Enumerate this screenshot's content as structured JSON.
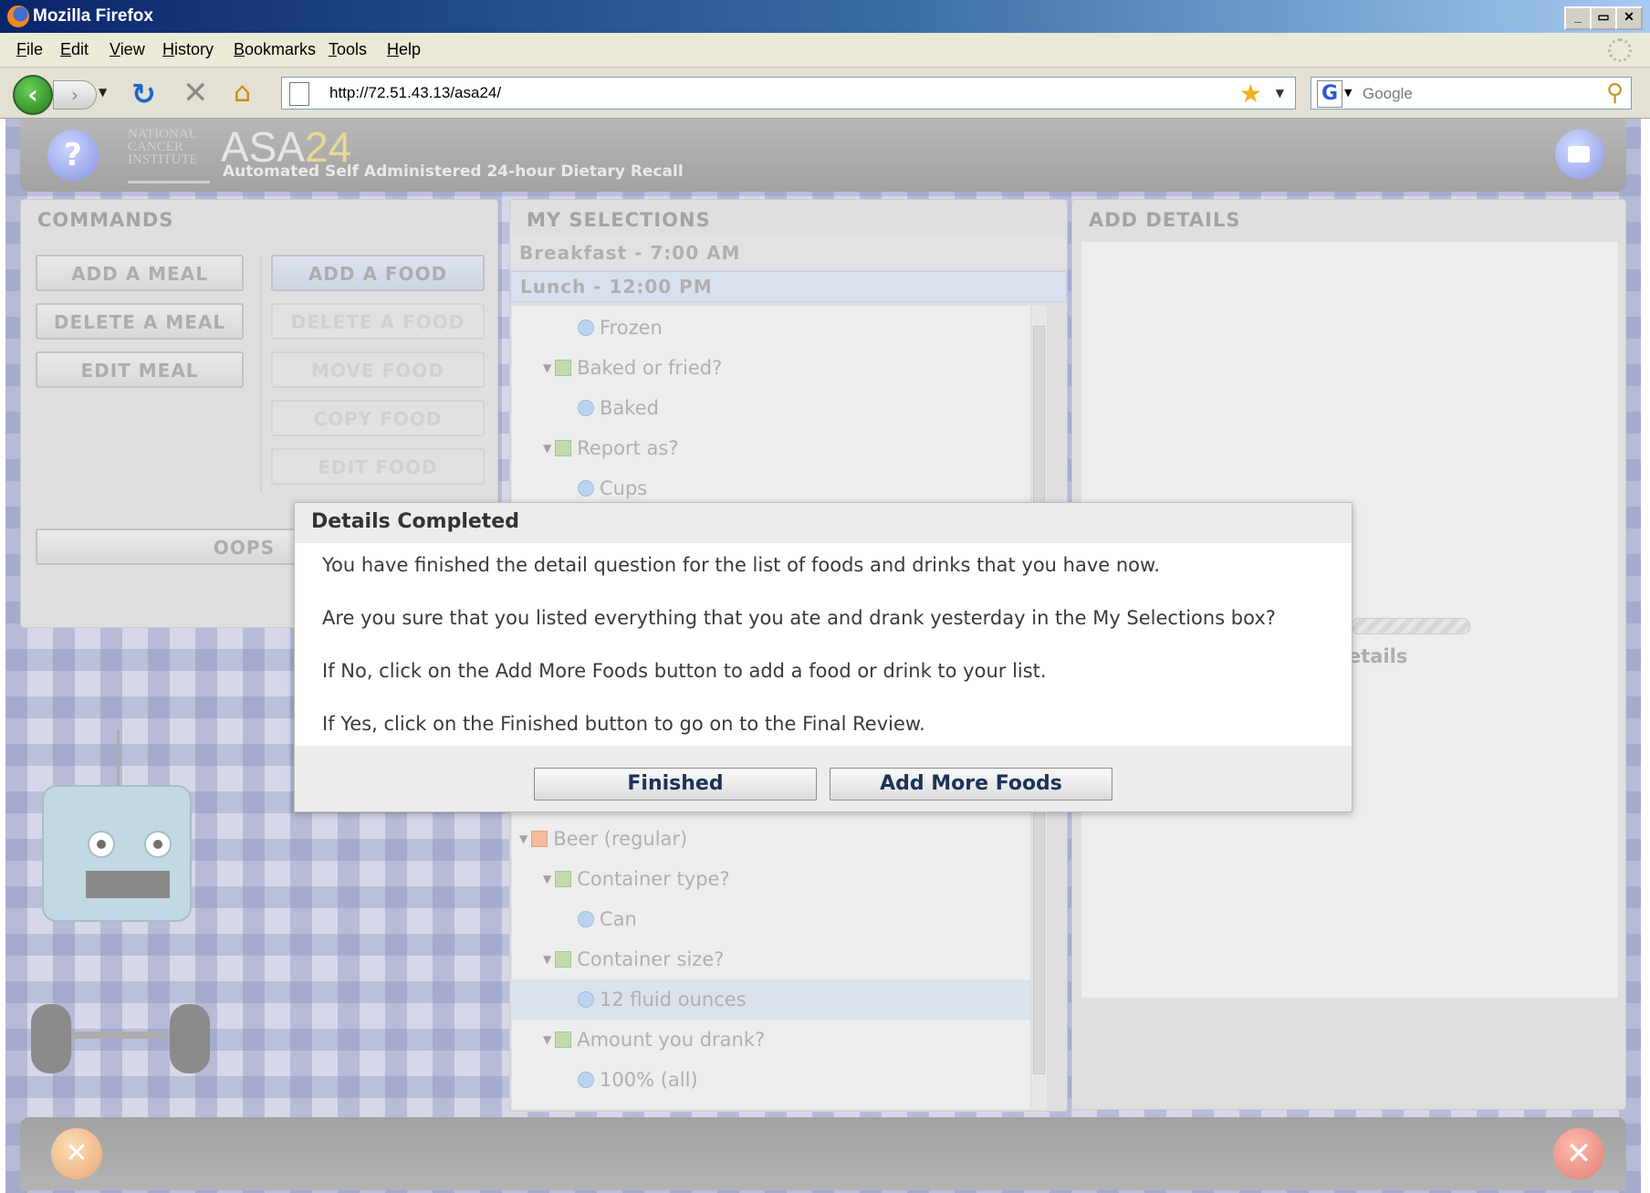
{
  "window": {
    "title": "Mozilla Firefox",
    "buttons": [
      "_",
      "▭",
      "✕"
    ]
  },
  "menu": [
    "File",
    "Edit",
    "View",
    "History",
    "Bookmarks",
    "Tools",
    "Help"
  ],
  "nav": {
    "url": "http://72.51.43.13/asa24/",
    "search_placeholder": "Google"
  },
  "app": {
    "logo_text": "ASA",
    "logo_num": "24",
    "nci_text": "NATIONAL CANCER INSTITUTE",
    "subtitle": "Automated Self Administered 24-hour Dietary Recall",
    "help_label": "?"
  },
  "commands": {
    "heading": "COMMANDS",
    "left": [
      "ADD A MEAL",
      "DELETE A MEAL",
      "EDIT MEAL"
    ],
    "right": [
      "ADD A FOOD",
      "DELETE A FOOD",
      "MOVE FOOD",
      "COPY FOOD",
      "EDIT FOOD"
    ],
    "oops": "OOPS"
  },
  "selections": {
    "heading": "MY SELECTIONS",
    "meals": [
      "Breakfast - 7:00 AM",
      "Lunch - 12:00 PM"
    ],
    "items_top": [
      "Frozen",
      "Baked or fried?",
      "Baked",
      "Report as?",
      "Cups"
    ],
    "items_bottom": [
      "Beer (regular)",
      "Container type?",
      "Can",
      "Container size?",
      "12 fluid ounces",
      "Amount you drank?",
      "100% (all)"
    ]
  },
  "details": {
    "heading": "ADD DETAILS",
    "partial": "etails"
  },
  "dialog": {
    "title": "Details Completed",
    "lines": [
      "You have finished the detail question for the list of foods and drinks that you have now.",
      "Are you sure that you listed everything that you ate and drank yesterday in the My Selections box?",
      "If No, click on the Add More Foods button to add a food or drink to your list.",
      "If Yes, click on the Finished button to go on to the Final Review."
    ],
    "finished": "Finished",
    "add_more": "Add More Foods"
  }
}
